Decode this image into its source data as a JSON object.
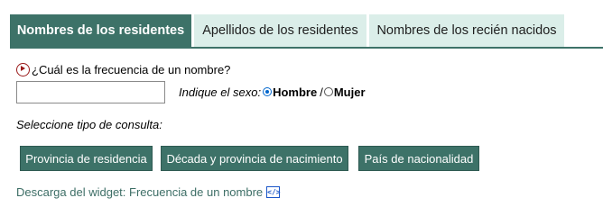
{
  "tabs": [
    {
      "label": "Nombres de los residentes",
      "active": true
    },
    {
      "label": "Apellidos de los residentes",
      "active": false
    },
    {
      "label": "Nombres de los recién nacidos",
      "active": false
    }
  ],
  "question": {
    "icon": "play-circle-icon",
    "text": "¿Cuál es la frecuencia de un nombre?"
  },
  "name_input": {
    "value": "",
    "placeholder": ""
  },
  "sex": {
    "label": "Indique el sexo:",
    "options": [
      {
        "label": "Hombre",
        "checked": true
      },
      {
        "label": "Mujer",
        "checked": false
      }
    ],
    "separator": "/"
  },
  "consulta_label": "Seleccione tipo de consulta:",
  "buttons": [
    {
      "label": "Provincia de residencia"
    },
    {
      "label": "Década y provincia de nacimiento"
    },
    {
      "label": "País de nacionalidad"
    }
  ],
  "download": {
    "text": "Descarga del widget: Frecuencia de un nombre",
    "icon": "embed-code-icon"
  },
  "colors": {
    "accent": "#3d7268",
    "tab_inactive_bg": "#dbeee9",
    "icon_red": "#9a1a1a",
    "link_blue": "#1a56c8"
  }
}
